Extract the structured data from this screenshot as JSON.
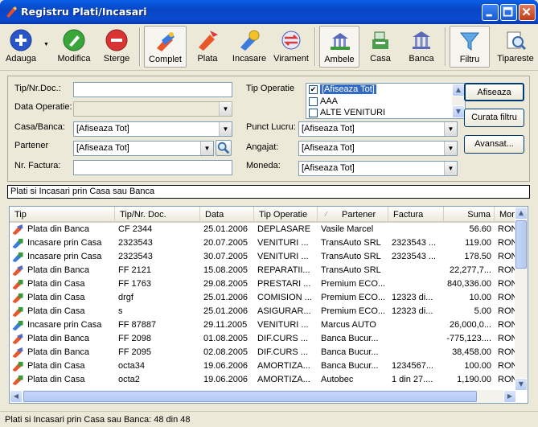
{
  "window": {
    "title": "Registru Plati/Incasari"
  },
  "toolbar": {
    "adauga": "Adauga",
    "modifica": "Modifica",
    "sterge": "Sterge",
    "complet": "Complet",
    "plata": "Plata",
    "incasare": "Incasare",
    "virament": "Virament",
    "ambele": "Ambele",
    "casa": "Casa",
    "banca": "Banca",
    "filtru": "Filtru",
    "tipareste": "Tipareste"
  },
  "filter": {
    "tip_doc_label": "Tip/Nr.Doc.:",
    "tip_doc_value": "",
    "data_label": "Data Operatie:",
    "data_value": "",
    "casa_label": "Casa/Banca:",
    "casa_value": "[Afiseaza Tot]",
    "partener_label": "Partener",
    "partener_value": "[Afiseaza Tot]",
    "factura_label": "Nr. Factura:",
    "factura_value": "",
    "tip_op_label": "Tip Operatie",
    "tip_op_items": [
      {
        "label": "[Afiseaza Tot]",
        "checked": true,
        "selected": true
      },
      {
        "label": "AAA",
        "checked": false,
        "selected": false
      },
      {
        "label": "ALTE VENITURI",
        "checked": false,
        "selected": false
      }
    ],
    "punct_label": "Punct Lucru:",
    "punct_value": "[Afiseaza Tot]",
    "angajat_label": "Angajat:",
    "angajat_value": "[Afiseaza Tot]",
    "moneda_label": "Moneda:",
    "moneda_value": "[Afiseaza Tot]",
    "afiseaza_button": "Afiseaza",
    "curata_button": "Curata filtru",
    "avansat_button": "Avansat..."
  },
  "caption": "Plati si Incasari prin Casa sau Banca",
  "table": {
    "columns": [
      "Tip",
      "Tip/Nr. Doc.",
      "Data",
      "Tip Operatie",
      "Partener",
      "Factura",
      "Suma",
      "Mon"
    ],
    "rows": [
      {
        "tip": "Plata din Banca",
        "doc": "CF 2344",
        "data": "25.01.2006",
        "op": "DEPLASARE",
        "partener": "Vasile Marcel",
        "factura": "",
        "suma": "56.60",
        "mon": "RON",
        "kind": "plata-banca"
      },
      {
        "tip": "Incasare prin Casa",
        "doc": "2323543",
        "data": "20.07.2005",
        "op": "VENITURI ...",
        "partener": "TransAuto SRL",
        "factura": "2323543 ...",
        "suma": "119.00",
        "mon": "RON",
        "kind": "incasare-casa"
      },
      {
        "tip": "Incasare prin Casa",
        "doc": "2323543",
        "data": "30.07.2005",
        "op": "VENITURI ...",
        "partener": "TransAuto SRL",
        "factura": "2323543 ...",
        "suma": "178.50",
        "mon": "RON",
        "kind": "incasare-casa"
      },
      {
        "tip": "Plata din Banca",
        "doc": "FF 2121",
        "data": "15.08.2005",
        "op": "REPARATII...",
        "partener": "TransAuto SRL",
        "factura": "",
        "suma": "22,277,7...",
        "mon": "RON",
        "kind": "plata-banca"
      },
      {
        "tip": "Plata din Casa",
        "doc": "FF 1763",
        "data": "29.08.2005",
        "op": "PRESTARI ...",
        "partener": "Premium ECO...",
        "factura": "",
        "suma": "840,336.00",
        "mon": "RON",
        "kind": "plata-casa"
      },
      {
        "tip": "Plata din Casa",
        "doc": "drgf",
        "data": "25.01.2006",
        "op": "COMISION ...",
        "partener": "Premium ECO...",
        "factura": "12323 di...",
        "suma": "10.00",
        "mon": "RON",
        "kind": "plata-casa"
      },
      {
        "tip": "Plata din Casa",
        "doc": "s",
        "data": "25.01.2006",
        "op": "ASIGURAR...",
        "partener": "Premium ECO...",
        "factura": "12323 di...",
        "suma": "5.00",
        "mon": "RON",
        "kind": "plata-casa"
      },
      {
        "tip": "Incasare prin Casa",
        "doc": "FF 87887",
        "data": "29.11.2005",
        "op": "VENITURI ...",
        "partener": "Marcus AUTO",
        "factura": "",
        "suma": "26,000,0...",
        "mon": "RON",
        "kind": "incasare-casa"
      },
      {
        "tip": "Plata din Banca",
        "doc": "FF 2098",
        "data": "01.08.2005",
        "op": "DIF.CURS ...",
        "partener": "Banca Bucur...",
        "factura": "",
        "suma": "-775,123....",
        "mon": "RON",
        "kind": "plata-banca"
      },
      {
        "tip": "Plata din Banca",
        "doc": "FF 2095",
        "data": "02.08.2005",
        "op": "DIF.CURS ...",
        "partener": "Banca Bucur...",
        "factura": "",
        "suma": "38,458.00",
        "mon": "RON",
        "kind": "plata-banca"
      },
      {
        "tip": "Plata din Casa",
        "doc": "octa34",
        "data": "19.06.2006",
        "op": "AMORTIZA...",
        "partener": "Banca Bucur...",
        "factura": "1234567...",
        "suma": "100.00",
        "mon": "RON",
        "kind": "plata-casa"
      },
      {
        "tip": "Plata din Casa",
        "doc": "octa2",
        "data": "19.06.2006",
        "op": "AMORTIZA...",
        "partener": "Autobec",
        "factura": "1 din 27....",
        "suma": "1,190.00",
        "mon": "RON",
        "kind": "plata-casa"
      }
    ]
  },
  "status": "Plati si Incasari prin Casa sau Banca: 48 din 48",
  "colors": {
    "accent": "#0a5fe6",
    "selection": "#316ac5"
  }
}
